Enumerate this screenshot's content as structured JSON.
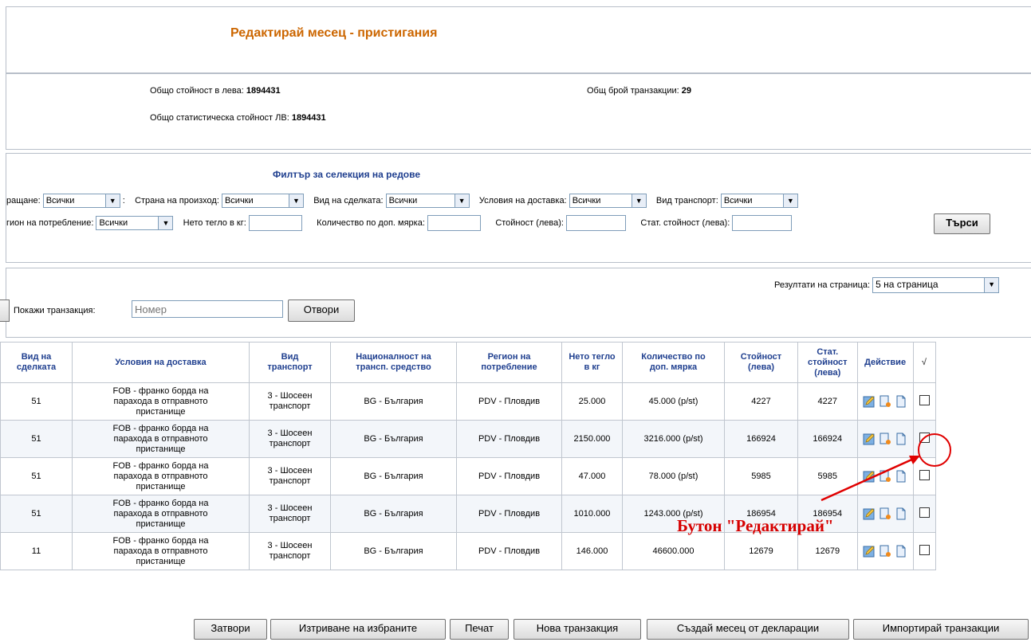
{
  "page": {
    "title": "Редактирай месец - пристигания"
  },
  "summary": {
    "total_value_label": "Общо стойност в лева:",
    "total_value": "1894431",
    "stat_value_label": "Общо статистическа стойност ЛВ:",
    "stat_value": "1894431",
    "transactions_label": "Общ брой транзакции:",
    "transactions_count": "29"
  },
  "filter": {
    "title": "Филтър за селекция на редове",
    "row1": {
      "dispatch_label": "ращане:",
      "dispatch_value": "Всички",
      "colon": ":",
      "origin_label": "Страна на произход:",
      "origin_value": "Всички",
      "deal_label": "Вид на сделката:",
      "deal_value": "Всички",
      "delivery_label": "Условия на доставка:",
      "delivery_value": "Всички",
      "transport_label": "Вид транспорт:",
      "transport_value": "Всички"
    },
    "row2": {
      "region_label": "гион на потребление:",
      "region_value": "Всички",
      "net_label": "Нето тегло в кг:",
      "qty_label": "Количество по доп. мярка:",
      "value_label": "Стойност (лева):",
      "stat_label": "Стат. стойност (лева):",
      "search_button": "Търси"
    }
  },
  "results": {
    "per_page_label": "Резултати на страница:",
    "per_page_value": "5  на страница"
  },
  "show_transaction": {
    "label": "Покажи транзакция:",
    "placeholder": "Номер",
    "open_button": "Отвори"
  },
  "table": {
    "headers": [
      "Вид на сделката",
      "Условия на доставка",
      "Вид транспорт",
      "Националност на трансп. средство",
      "Регион на потребление",
      "Нето тегло в кг",
      "Количество по доп. мярка",
      "Стойност (лева)",
      "Стат. стойност (лева)",
      "Действие",
      "√"
    ],
    "rows": [
      [
        "51",
        "FOB - франко борда на парахода в отправното пристанище",
        "3 - Шосеен транспорт",
        "BG - България",
        "PDV - Пловдив",
        "25.000",
        "45.000 (p/st)",
        "4227",
        "4227"
      ],
      [
        "51",
        "FOB - франко борда на парахода в отправното пристанище",
        "3 - Шосеен транспорт",
        "BG - България",
        "PDV - Пловдив",
        "2150.000",
        "3216.000 (p/st)",
        "166924",
        "166924"
      ],
      [
        "51",
        "FOB - франко борда на парахода в отправното пристанище",
        "3 - Шосеен транспорт",
        "BG - България",
        "PDV - Пловдив",
        "47.000",
        "78.000 (p/st)",
        "5985",
        "5985"
      ],
      [
        "51",
        "FOB - франко борда на парахода в отправното пристанище",
        "3 - Шосеен транспорт",
        "BG - България",
        "PDV - Пловдив",
        "1010.000",
        "1243.000 (p/st)",
        "186954",
        "186954"
      ],
      [
        "11",
        "FOB - франко борда на парахода в отправното пристанище",
        "3 - Шосеен транспорт",
        "BG - България",
        "PDV - Пловдив",
        "146.000",
        "46600.000",
        "12679",
        "12679"
      ]
    ]
  },
  "footer_buttons": {
    "close": "Затвори",
    "delete_selected": "Изтриване на избраните",
    "print": "Печат",
    "new_transaction": "Нова транзакция",
    "create_month": "Създай месец от декларации",
    "import": "Импортирай транзакции"
  },
  "annotation": {
    "text": "Бутон \"Редактирай\"",
    "color": "#d60000"
  },
  "colors": {
    "title": "#cc6600",
    "header_text": "#1f3f8f",
    "border": "#b8bfc9"
  }
}
